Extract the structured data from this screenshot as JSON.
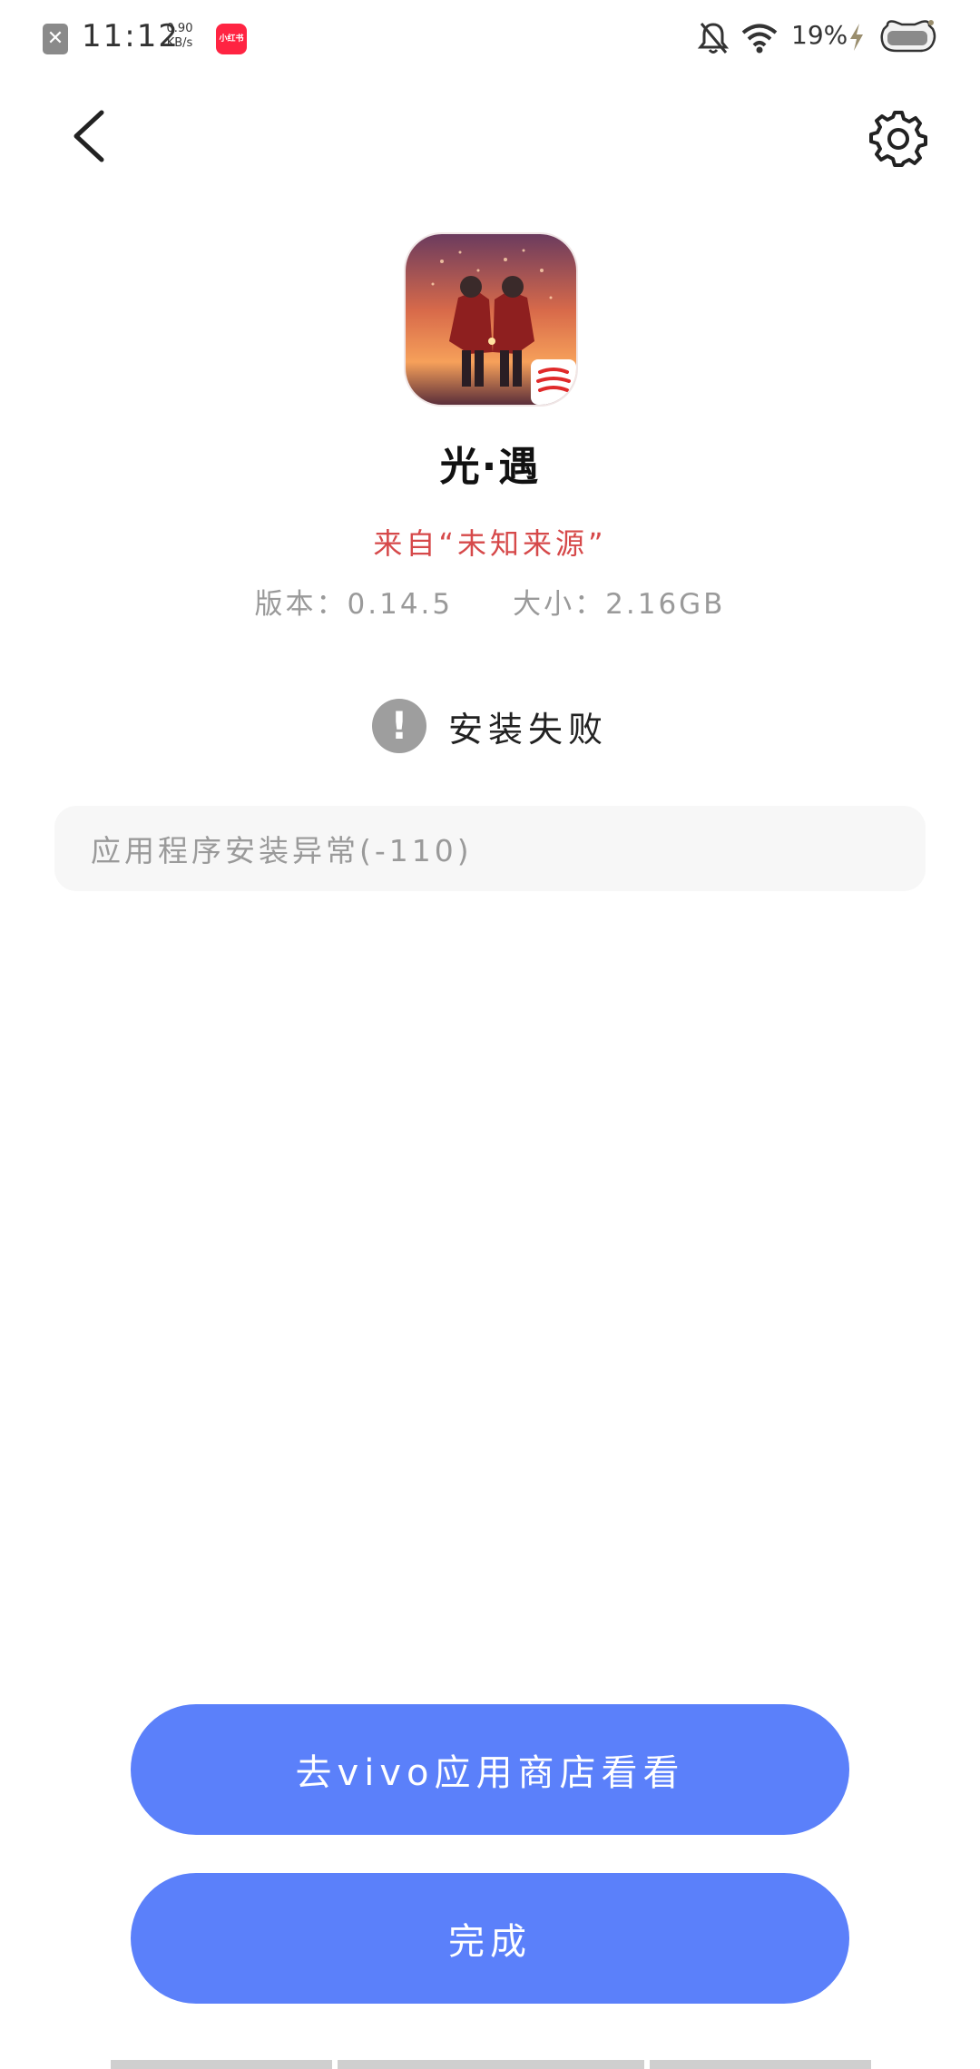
{
  "status_bar": {
    "time": "11:12",
    "net_speed_value": "0.90",
    "net_speed_unit": "KB/s",
    "app_badge": "小红书",
    "battery_percent": "19%",
    "icons": [
      "close-icon",
      "bell-off-icon",
      "wifi-icon",
      "charging-bolt-icon",
      "battery-icon"
    ]
  },
  "toolbar": {
    "back_icon": "chevron-left-icon",
    "settings_icon": "gear-icon"
  },
  "app": {
    "name": "光·遇",
    "source": "来自“未知来源”",
    "version_label": "版本：",
    "version": "0.14.5",
    "size_label": "大小：",
    "size": "2.16GB"
  },
  "install": {
    "status_icon": "exclamation-icon",
    "status_text": "安装失败",
    "error_message": "应用程序安装异常(-110)"
  },
  "buttons": {
    "store_label": "去vivo应用商店看看",
    "done_label": "完成"
  },
  "colors": {
    "primary": "#5b80fa",
    "source_red": "#d6494a",
    "muted_text": "#9a9a9a",
    "error_bg": "#f7f7f7"
  }
}
